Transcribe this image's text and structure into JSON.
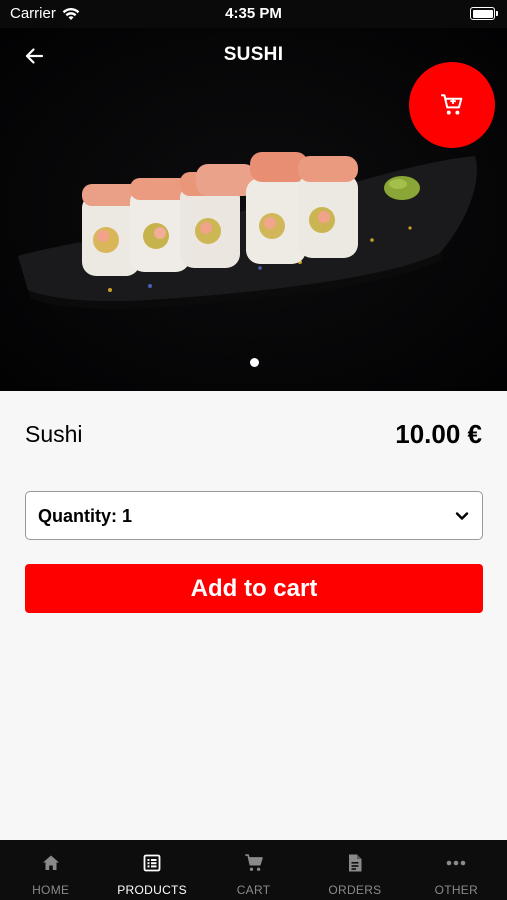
{
  "status_bar": {
    "carrier": "Carrier",
    "time": "4:35 PM"
  },
  "header": {
    "title": "SUSHI",
    "back_icon": "arrow-left-icon",
    "cart_icon": "cart-icon"
  },
  "gallery": {
    "image_count": 1,
    "active_index": 0
  },
  "product": {
    "name": "Sushi",
    "price": "10.00 €"
  },
  "quantity": {
    "label": "Quantity: 1",
    "value": 1
  },
  "add_to_cart_label": "Add to cart",
  "colors": {
    "accent": "#ff0000",
    "tab_bar": "#0d0d0d",
    "tab_active": "#ffffff",
    "tab_inactive": "#8a8a8a"
  },
  "tabs": [
    {
      "label": "HOME",
      "icon": "home-icon",
      "active": false
    },
    {
      "label": "PRODUCTS",
      "icon": "list-icon",
      "active": true
    },
    {
      "label": "CART",
      "icon": "cart-icon",
      "active": false
    },
    {
      "label": "ORDERS",
      "icon": "document-icon",
      "active": false
    },
    {
      "label": "OTHER",
      "icon": "more-icon",
      "active": false
    }
  ]
}
